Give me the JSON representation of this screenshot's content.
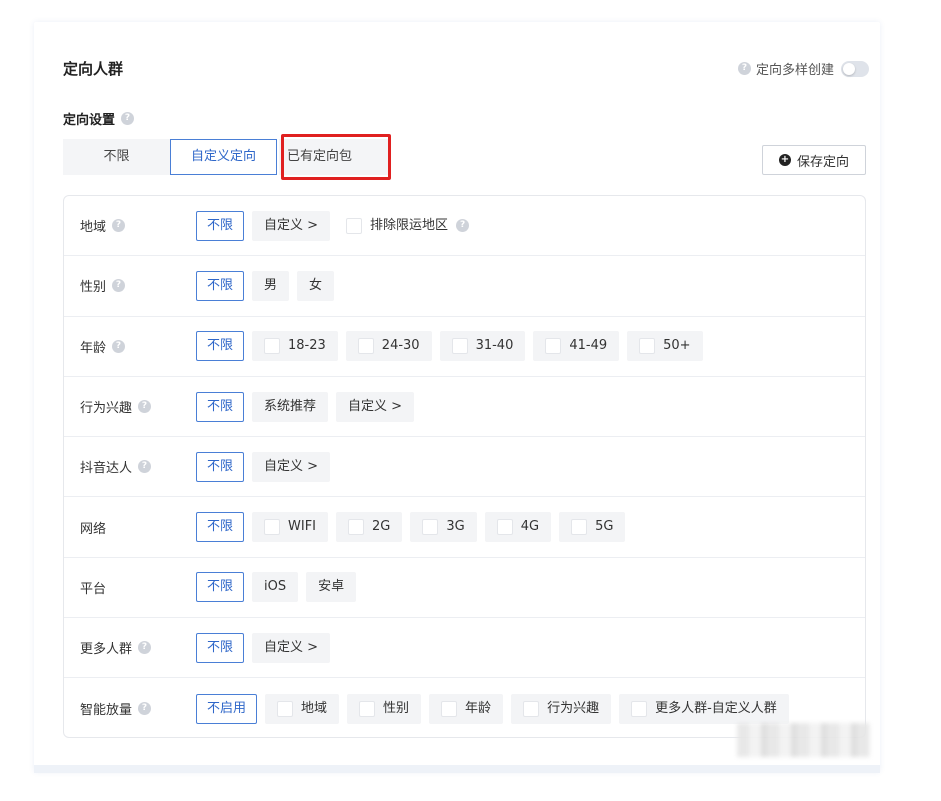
{
  "section_title": "定向人群",
  "multi_create": {
    "label": "定向多样创建",
    "enabled": false
  },
  "settings_title": "定向设置",
  "tabs": [
    {
      "label": "不限",
      "active": false
    },
    {
      "label": "自定义定向",
      "active": true
    },
    {
      "label": "已有定向包",
      "active": false
    }
  ],
  "save_button": "保存定向",
  "rows": [
    {
      "label": "地域",
      "help": true,
      "options": [
        "不限",
        "自定义 >",
        "排除限运地区"
      ]
    },
    {
      "label": "性别",
      "help": true,
      "options": [
        "不限",
        "男",
        "女"
      ]
    },
    {
      "label": "年龄",
      "help": true,
      "options": [
        "不限",
        "18-23",
        "24-30",
        "31-40",
        "41-49",
        "50+"
      ]
    },
    {
      "label": "行为兴趣",
      "help": true,
      "options": [
        "不限",
        "系统推荐",
        "自定义 >"
      ]
    },
    {
      "label": "抖音达人",
      "help": true,
      "options": [
        "不限",
        "自定义 >"
      ]
    },
    {
      "label": "网络",
      "help": false,
      "options": [
        "不限",
        "WIFI",
        "2G",
        "3G",
        "4G",
        "5G"
      ]
    },
    {
      "label": "平台",
      "help": false,
      "options": [
        "不限",
        "iOS",
        "安卓"
      ]
    },
    {
      "label": "更多人群",
      "help": true,
      "options": [
        "不限",
        "自定义 >"
      ]
    },
    {
      "label": "智能放量",
      "help": true,
      "options": [
        "不启用",
        "地域",
        "性别",
        "年龄",
        "行为兴趣",
        "更多人群-自定义人群"
      ]
    }
  ],
  "icons": {
    "help": "question-circle-icon",
    "plus": "plus-circle-icon"
  },
  "colors": {
    "accent": "#2f67c9",
    "highlight": "#e02020"
  }
}
